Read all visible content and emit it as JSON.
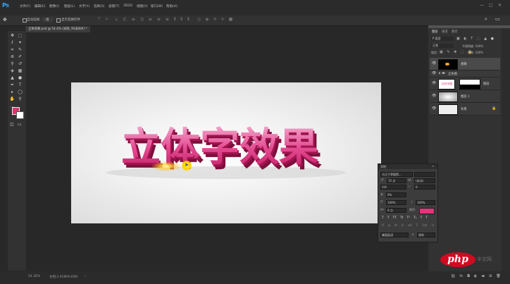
{
  "app": {
    "logo": "Ps"
  },
  "menu": {
    "items": [
      "文件(F)",
      "编辑(E)",
      "图像(I)",
      "图层(L)",
      "文字(Y)",
      "选择(S)",
      "滤镜(T)",
      "3D(D)",
      "视图(V)",
      "窗口(W)",
      "帮助(H)"
    ]
  },
  "options_bar": {
    "auto_select": "自动选择:",
    "group": "组",
    "show_transform": "显示变换控件"
  },
  "document": {
    "tab_label": "立体效果.psd @ 54.4% (光效, RGB/8#) *",
    "headline": "立体字效果"
  },
  "status": {
    "zoom": "54.36%",
    "doc_size": "文档:2.91M/9.65M"
  },
  "layers_panel": {
    "tabs": [
      "图层",
      "通道",
      "路径"
    ],
    "filter": "P 类型",
    "blend_mode": "正常",
    "opacity": "不透明度: 100%",
    "lock_label": "锁定:",
    "fill": "填充: 100%",
    "layers": [
      {
        "name": "光效",
        "selected": true
      },
      {
        "name": "立体图",
        "is_group": true
      },
      {
        "name": "图层",
        "thumb_text": "立体字效果"
      },
      {
        "name": "图层 1"
      },
      {
        "name": "背景"
      }
    ]
  },
  "char_panel": {
    "title": "字符",
    "font_family": "方正兰亭粗黑...",
    "font_size": "72 点",
    "leading": "(自动)",
    "kerning": "V/A",
    "tracking": "0",
    "scale_v": "100%",
    "scale_h": "100%",
    "baseline": "0 点",
    "tracking_pct": "0%",
    "color_label": "颜色:",
    "color": "#e0367a",
    "language": "美国英语",
    "aa_value": "锐利",
    "aa_prefix": "a"
  },
  "watermark": {
    "brand": "php",
    "suffix": "中文网"
  }
}
